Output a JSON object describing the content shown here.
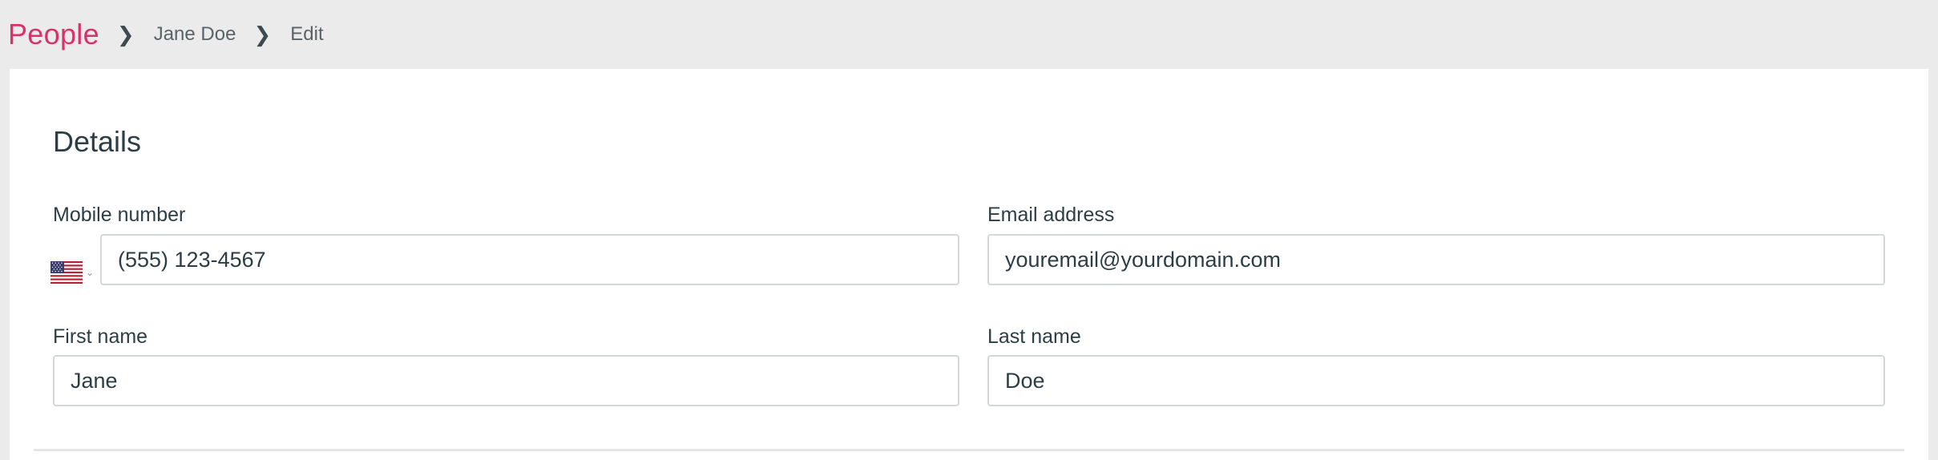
{
  "breadcrumb": {
    "root": "People",
    "person": "Jane Doe",
    "current": "Edit",
    "separator": "❯"
  },
  "details": {
    "title": "Details",
    "mobile": {
      "label": "Mobile number",
      "value": "(555) 123-4567",
      "country_icon": "us-flag-icon"
    },
    "email": {
      "label": "Email address",
      "placeholder": "youremail@yourdomain.com",
      "value": ""
    },
    "first_name": {
      "label": "First name",
      "value": "Jane"
    },
    "last_name": {
      "label": "Last name",
      "value": "Doe"
    }
  },
  "colors": {
    "brand": "#d6336c",
    "text": "#2c3e45",
    "border": "#d4d7d8",
    "background": "#ebebeb"
  }
}
